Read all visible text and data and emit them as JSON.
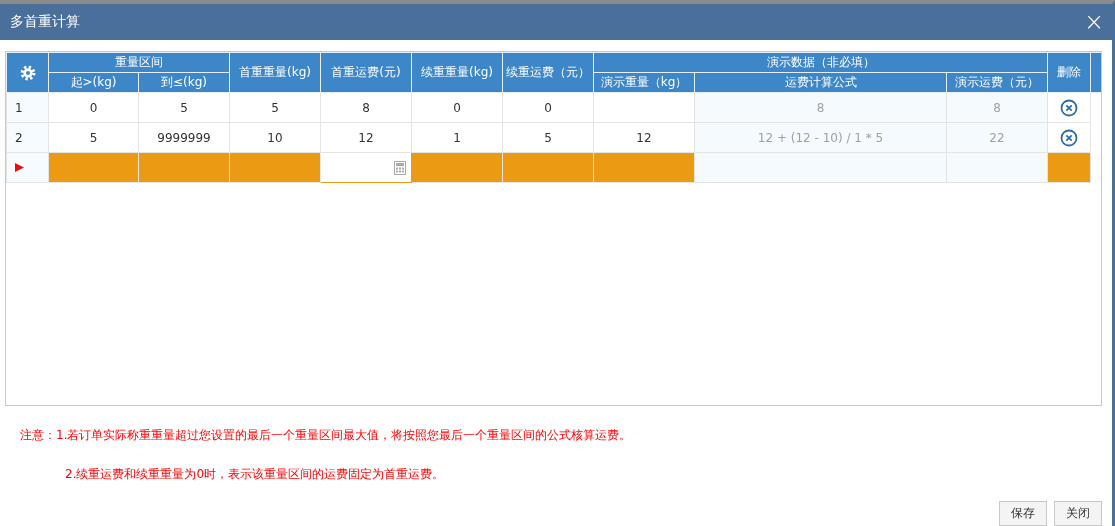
{
  "window": {
    "title": "多首重计算",
    "close": "×"
  },
  "table": {
    "range_group": "重量区间",
    "range_columns": [
      "起>(kg)",
      "到≤(kg)"
    ],
    "columns": [
      "首重重量(kg)",
      "首重运费(元)",
      "续重重量(kg)",
      "续重运费（元）"
    ],
    "demo_group": "演示数据（非必填）",
    "demo_columns": [
      "演示重量（kg）",
      "运费计算公式",
      "演示运费（元）"
    ],
    "delete_column": "删除",
    "rows": [
      {
        "number": "1",
        "selected": false,
        "start": "0",
        "end": "5",
        "first_weight": "5",
        "first_fee": "8",
        "extra_weight": "0",
        "extra_fee": "0",
        "formula": "8",
        "demo_fee": "8"
      },
      {
        "number": "2",
        "selected": false,
        "start": "5",
        "end": "9999999",
        "first_weight": "10",
        "first_fee": "12",
        "extra_weight": "1",
        "extra_fee": "5",
        "demo_weight": "12",
        "formula": "12 + (12 - 10) / 1 * 5",
        "demo_fee": "22"
      }
    ],
    "new_row": {
      "selected": true,
      "cells": [
        {
          "kind": "blank"
        },
        {
          "kind": "blank"
        },
        {
          "kind": "blank"
        },
        {
          "kind": "input"
        },
        {
          "kind": "blank"
        },
        {
          "kind": "blank"
        },
        {
          "kind": "blank"
        },
        {
          "kind": "demo"
        },
        {
          "kind": "demo"
        },
        {
          "kind": "blank"
        }
      ]
    }
  },
  "notes": [
    "注意：1.若订单实际称重重量超过您设置的最后一个重量区间最大值，将按照您最后一个重量区间的公式核算运费。",
    "2.续重运费和续重重量为0时，表示该重量区间的运费固定为首重运费。"
  ],
  "buttons": [
    "保存",
    "关闭"
  ]
}
